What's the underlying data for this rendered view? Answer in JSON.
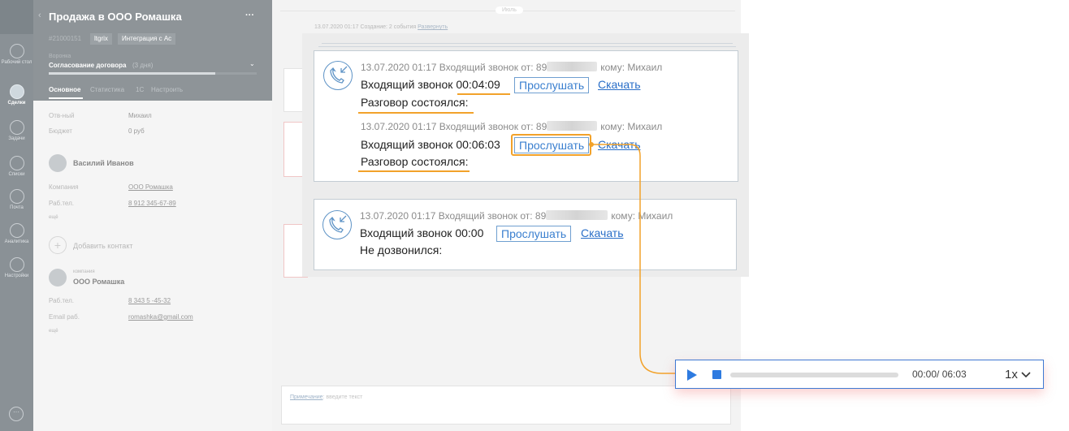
{
  "sidebar": {
    "items": [
      {
        "label": "Рабочий стол",
        "icon": "dashboard-icon"
      },
      {
        "label": "Сделки",
        "icon": "deals-icon"
      },
      {
        "label": "Задачи",
        "icon": "tasks-icon"
      },
      {
        "label": "Списки",
        "icon": "lists-icon"
      },
      {
        "label": "Почта",
        "icon": "mail-icon"
      },
      {
        "label": "Аналитика",
        "icon": "analytics-icon"
      },
      {
        "label": "Настройки",
        "icon": "settings-icon"
      }
    ]
  },
  "deal": {
    "title": "Продажа в ООО Ромашка",
    "more": "···",
    "id": "#21000151",
    "tags": [
      "ltgrix",
      "Интеграция с Ас"
    ],
    "pipeline_label": "Воронка",
    "pipeline_stage": "Согласование договора",
    "pipeline_days": "(3 дня)",
    "progress": 0.8,
    "tabs": [
      "Основное",
      "Статистика",
      "1С",
      "Настроить"
    ],
    "fields": {
      "responsible_label": "Отв-ный",
      "responsible_value": "Михаил",
      "budget_label": "Бюджет",
      "budget_value": "0 руб"
    },
    "contact": {
      "name": "Василий Иванов",
      "company_label": "Компания",
      "company_value": "ООО Ромашка",
      "phone_label": "Раб.тел.",
      "phone_value": "8 912 345-67-89",
      "more": "ещё"
    },
    "add_contact": "Добавить контакт",
    "company": {
      "small_label": "компания",
      "name": "ООО Ромашка",
      "phone_label": "Раб.тел.",
      "phone_value": "8 343 5  -45-32",
      "email_label": "Email раб.",
      "email_value": "romashka@gmail.com",
      "more": "ещё"
    }
  },
  "feed": {
    "month": "Июль",
    "summary": "13.07.2020 01:17 Создание: 2 события",
    "summary_link": "Развернуть",
    "note_link": "Примечание",
    "note_placeholder": ": введите текст"
  },
  "calls": [
    {
      "meta_prefix": "13.07.2020 01:17 Входящий звонок от: 89",
      "meta_suffix": "кому: Михаил",
      "line": "Входящий звонок 00:04:09",
      "listen": "Прослушать",
      "download": "Скачать",
      "status": "Разговор состоялся:"
    },
    {
      "meta_prefix": "13.07.2020 01:17 Входящий звонок от: 89",
      "meta_suffix": "кому: Михаил",
      "line": "Входящий звонок 00:06:03",
      "listen": "Прослушать",
      "download": "Скачать",
      "status": "Разговор состоялся:"
    },
    {
      "meta_prefix": "13.07.2020 01:17 Входящий звонок от: 89",
      "meta_suffix": "кому: Михаил",
      "line": "Входящий звонок 00:00",
      "listen": "Прослушать",
      "download": "Скачать",
      "status": "Не дозвонился:"
    }
  ],
  "player": {
    "time": "00:00/ 06:03",
    "speed": "1x",
    "progress": 0
  },
  "colors": {
    "accent": "#2e7be0",
    "highlight": "#f2a22a",
    "sidebar": "#8a9196"
  }
}
